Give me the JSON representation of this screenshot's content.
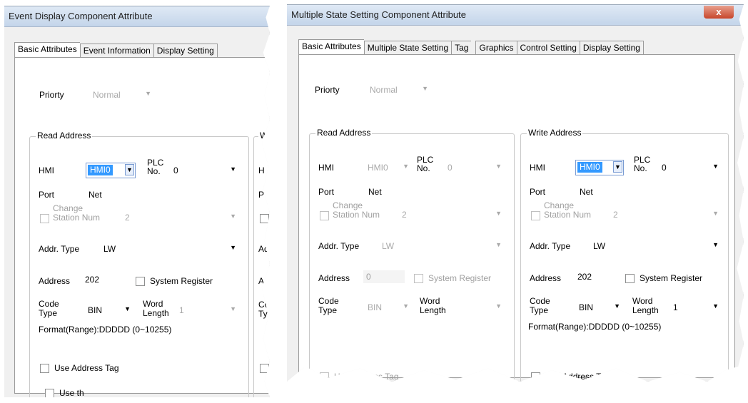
{
  "left_dialog": {
    "title": "Event Display Component Attribute",
    "tabs": [
      "Basic Attributes",
      "Event Information",
      "Display Setting"
    ],
    "priority_label": "Priorty",
    "priority_value": "Normal",
    "read_group_title": "Read Address",
    "write_group_partial": "W",
    "hmi_label": "HMI",
    "hmi_value": "HMI0",
    "plc_no_label": "PLC\nNo.",
    "plc_no_value": "0",
    "port_label": "Port",
    "port_value": "Net",
    "change_station_label": "Change\nStation Num",
    "change_station_value": "2",
    "addr_type_label": "Addr. Type",
    "addr_type_value": "LW",
    "address_label": "Address",
    "address_value": "202",
    "system_register_label": "System Register",
    "code_type_label": "Code\nType",
    "code_type_value": "BIN",
    "word_length_label": "Word\nLength",
    "word_length_value": "1",
    "format_range": "Format(Range):DDDDD (0~10255)",
    "use_address_tag_label": "Use Address Tag",
    "use_the_partial": "Use th",
    "right_fragments": [
      "H",
      "P",
      "Ad",
      "Ad",
      "Co",
      "Ty"
    ]
  },
  "right_dialog": {
    "title": "Multiple State Setting Component Attribute",
    "close_icon_glyph": "x",
    "tabs": [
      "Basic Attributes",
      "Multiple State Setting",
      "Tag",
      "Graphics",
      "Control Setting",
      "Display Setting"
    ],
    "priority_label": "Priorty",
    "priority_value": "Normal",
    "read": {
      "group_title": "Read Address",
      "hmi_label": "HMI",
      "hmi_value": "HMI0",
      "plc_no_label": "PLC\nNo.",
      "plc_no_value": "0",
      "port_label": "Port",
      "port_value": "Net",
      "change_station_label": "Change\nStation Num",
      "change_station_value": "2",
      "addr_type_label": "Addr. Type",
      "addr_type_value": "LW",
      "address_label": "Address",
      "address_value": "0",
      "system_register_label": "System Register",
      "code_type_label": "Code\nType",
      "code_type_value": "BIN",
      "word_length_label": "Word\nLength",
      "use_address_tag_label": "Use Address Tag"
    },
    "write": {
      "group_title": "Write Address",
      "hmi_label": "HMI",
      "hmi_value": "HMI0",
      "plc_no_label": "PLC\nNo.",
      "plc_no_value": "0",
      "port_label": "Port",
      "port_value": "Net",
      "change_station_label": "Change\nStation Num",
      "change_station_value": "2",
      "addr_type_label": "Addr. Type",
      "addr_type_value": "LW",
      "address_label": "Address",
      "address_value": "202",
      "system_register_label": "System Register",
      "code_type_label": "Code\nType",
      "code_type_value": "BIN",
      "word_length_label": "Word\nLength",
      "word_length_value": "1",
      "format_range": "Format(Range):DDDDD (0~10255)",
      "use_address_tag_label": "Use Address Tag"
    }
  },
  "colors": {
    "selection_blue": "#3399ff",
    "disabled_text": "#a0a0a0",
    "close_red": "#c7452b"
  }
}
